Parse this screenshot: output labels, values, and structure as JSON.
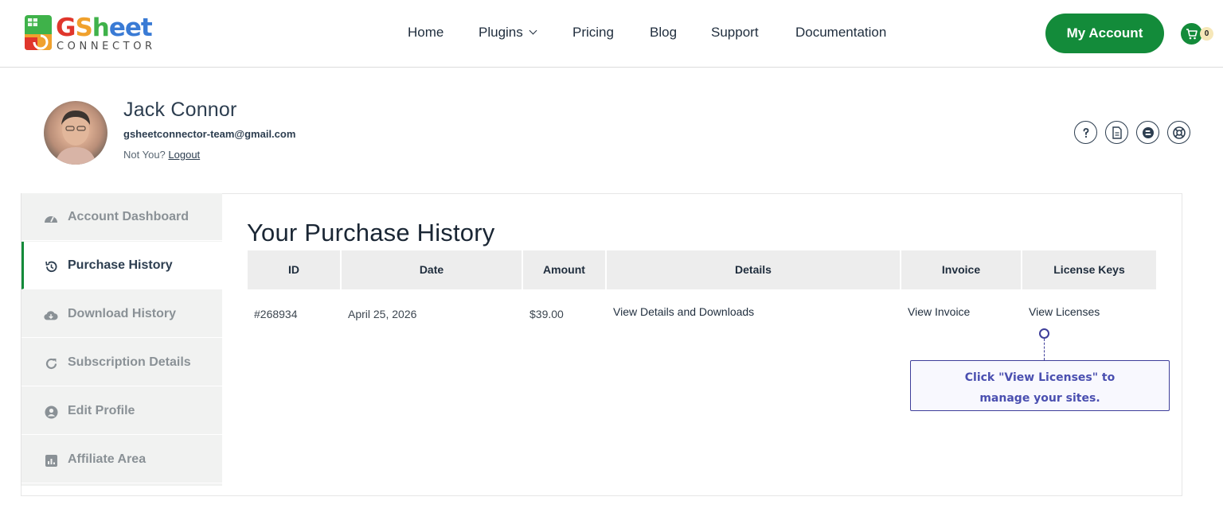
{
  "header": {
    "logo": {
      "title": "GSheet",
      "subtitle": "CONNECTOR"
    },
    "nav": [
      {
        "label": "Home"
      },
      {
        "label": "Plugins"
      },
      {
        "label": "Pricing"
      },
      {
        "label": "Blog"
      },
      {
        "label": "Support"
      },
      {
        "label": "Documentation"
      }
    ],
    "account_button": "My Account",
    "cart_count": "0"
  },
  "profile": {
    "name": "Jack Connor",
    "email": "gsheetconnector-team@gmail.com",
    "not_you": "Not You?",
    "logout": "Logout",
    "action_icons": [
      "help-icon",
      "document-icon",
      "blog-icon",
      "support-lifebuoy-icon"
    ]
  },
  "sidebar": {
    "items": [
      {
        "label": "Account Dashboard",
        "icon": "dashboard-gauge-icon",
        "active": false
      },
      {
        "label": "Purchase History",
        "icon": "history-icon",
        "active": true
      },
      {
        "label": "Download History",
        "icon": "cloud-download-icon",
        "active": false
      },
      {
        "label": "Subscription Details",
        "icon": "refresh-icon",
        "active": false
      },
      {
        "label": "Edit Profile",
        "icon": "user-circle-icon",
        "active": false
      },
      {
        "label": "Affiliate Area",
        "icon": "bar-chart-icon",
        "active": false
      }
    ]
  },
  "main": {
    "title": "Your Purchase History",
    "table": {
      "headers": [
        "ID",
        "Date",
        "Amount",
        "Details",
        "Invoice",
        "License Keys"
      ],
      "rows": [
        {
          "id": "#268934",
          "date": "April 25, 2026",
          "amount": "$39.00",
          "details": "View Details and Downloads",
          "invoice": "View Invoice",
          "license": "View Licenses"
        }
      ]
    },
    "tooltip": {
      "line1": "Click \"View Licenses\" to",
      "line2": "manage your sites."
    }
  },
  "colors": {
    "brand_green": "#138b3a",
    "tooltip_accent": "#3e3e9a",
    "header_bg": "#ededed",
    "sidebar_bg": "#f1f2f1"
  }
}
